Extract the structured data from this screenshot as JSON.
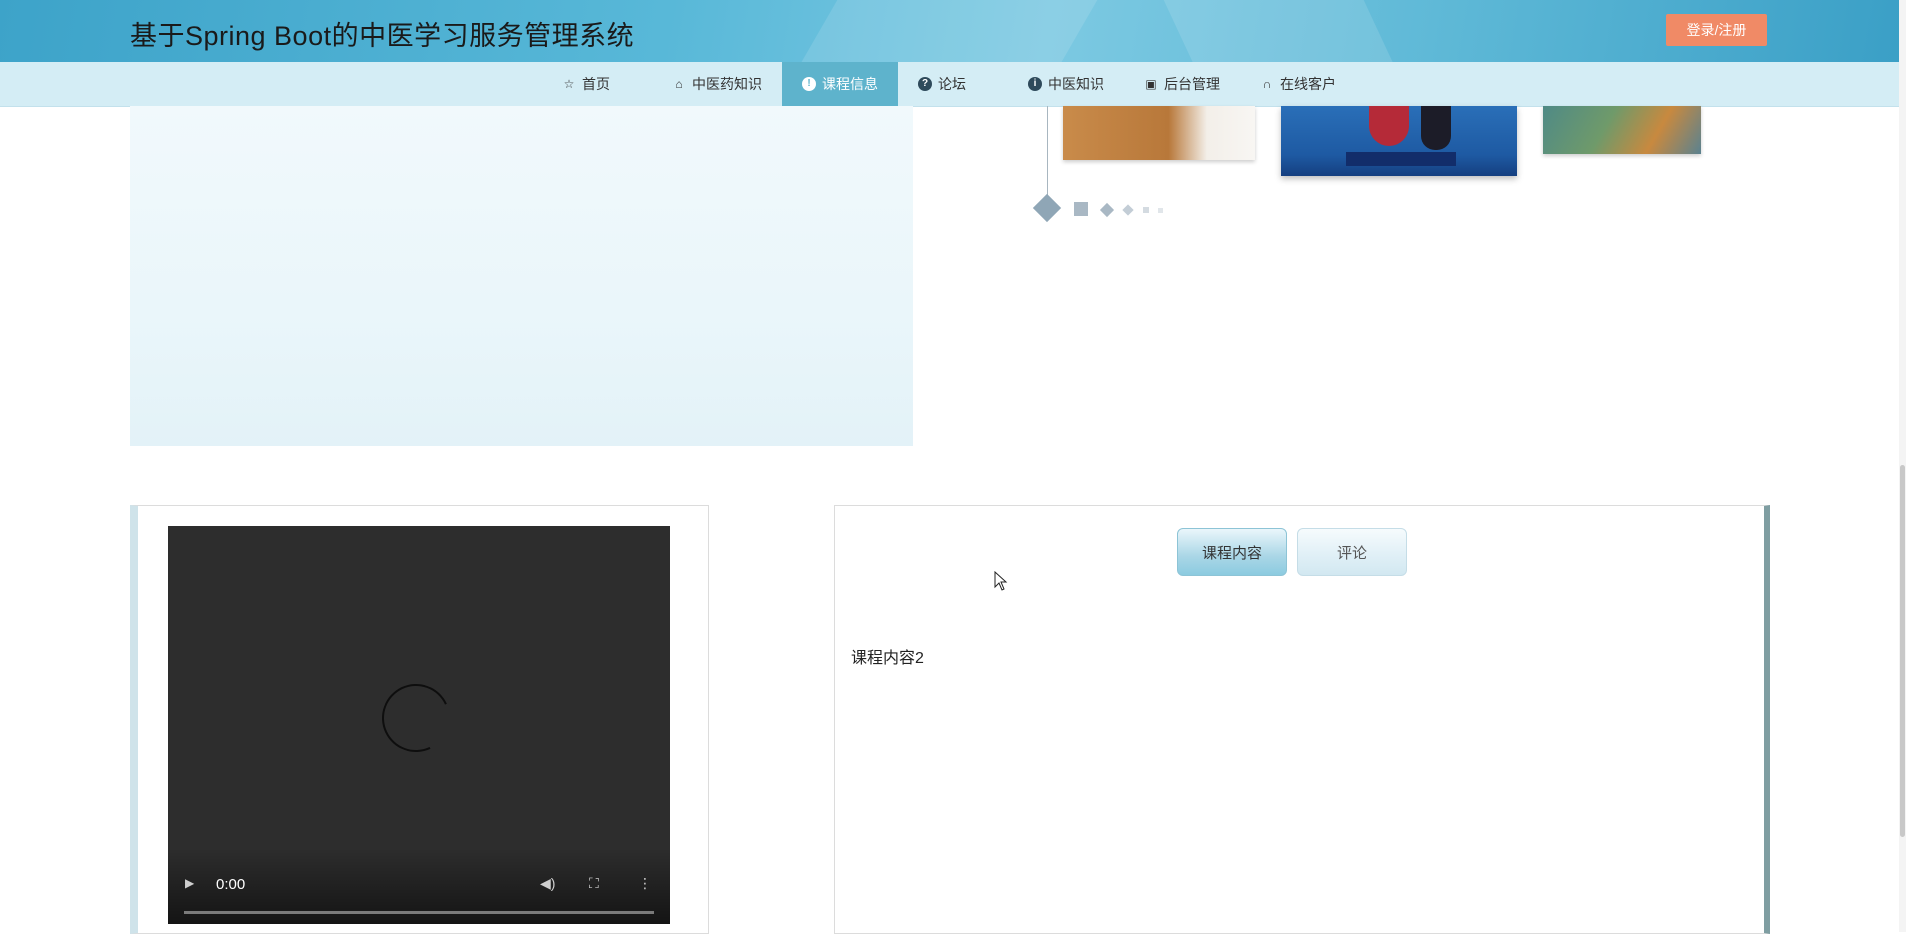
{
  "header": {
    "site_title": "基于Spring Boot的中医学习服务管理系统",
    "login_label": "登录/注册"
  },
  "nav": {
    "items": [
      {
        "label": "首页",
        "icon": "star-icon"
      },
      {
        "label": "中医药知识",
        "icon": "bag-icon"
      },
      {
        "label": "课程信息",
        "icon": "info-icon",
        "active": true
      },
      {
        "label": "论坛",
        "icon": "question-icon"
      },
      {
        "label": "中医知识",
        "icon": "info-icon"
      },
      {
        "label": "后台管理",
        "icon": "briefcase-icon"
      },
      {
        "label": "在线客户",
        "icon": "headset-icon"
      }
    ]
  },
  "video": {
    "time": "0:00"
  },
  "content": {
    "tabs": [
      {
        "label": "课程内容",
        "active": true
      },
      {
        "label": "评论"
      }
    ],
    "text": "课程内容2"
  },
  "colors": {
    "header": "#58b8d8",
    "nav_bg": "#d4edf5",
    "nav_active": "#5eb3cc",
    "login_button": "#f08a66"
  }
}
